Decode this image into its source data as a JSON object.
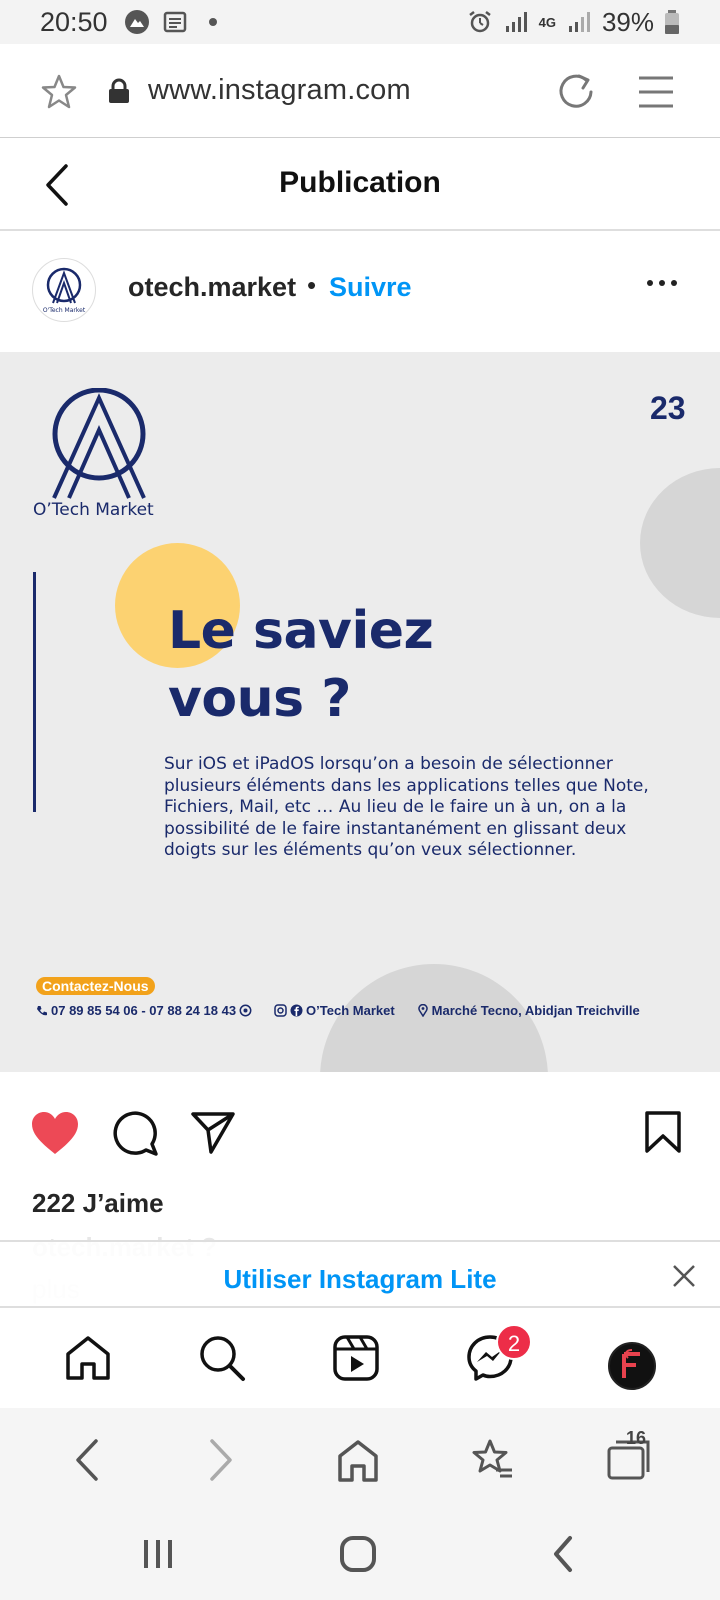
{
  "status_bar": {
    "time": "20:50",
    "network": "4G",
    "battery": "39%",
    "icons": [
      "mountain-icon",
      "news-icon",
      "dot-icon",
      "alarm-icon",
      "signal-icon",
      "signal-icon-2",
      "battery-icon"
    ]
  },
  "browser": {
    "url": "www.instagram.com",
    "tabs_count": "16",
    "icons": [
      "star-icon",
      "lock-icon",
      "reload-icon",
      "menu-icon",
      "back-arrow-icon",
      "forward-arrow-icon",
      "home-icon",
      "bookmarks-icon",
      "tabs-icon"
    ]
  },
  "ig_header": {
    "title": "Publication"
  },
  "post": {
    "username": "otech.market",
    "separator": "•",
    "follow_label": "Suivre",
    "image": {
      "brand_name": "O’Tech Market",
      "number": "23",
      "headline_line1": "Le saviez",
      "headline_line2": "vous ?",
      "body": "Sur iOS et iPadOS lorsqu’on a besoin de sélectionner plusieurs éléments dans les applications telles que Note, Fichiers, Mail, etc … Au lieu de le faire un à un, on a la possibilité de le faire instantanément en glissant deux doigts sur les éléments qu’on veux sélectionner.",
      "contact_label": "Contactez-Nous",
      "phone": "07 89 85 54 06 - 07 88 24 18 43",
      "social": "O’Tech Market",
      "address": "Marché Tecno, Abidjan Treichville",
      "accent_yellow": "#fcd271",
      "navy": "#1a2a6b",
      "orange": "#f2a21b"
    },
    "likes": "222 J’aime",
    "caption_user": "otech.market ?",
    "caption_more": "plus"
  },
  "lite_banner": {
    "label": "Utiliser Instagram Lite"
  },
  "ig_nav": {
    "messages_badge": "2",
    "icons": [
      "home-icon",
      "search-icon",
      "reels-icon",
      "messenger-icon",
      "profile-avatar"
    ]
  },
  "colors": {
    "like_red": "#ed4956",
    "ig_blue": "#0095f6"
  }
}
